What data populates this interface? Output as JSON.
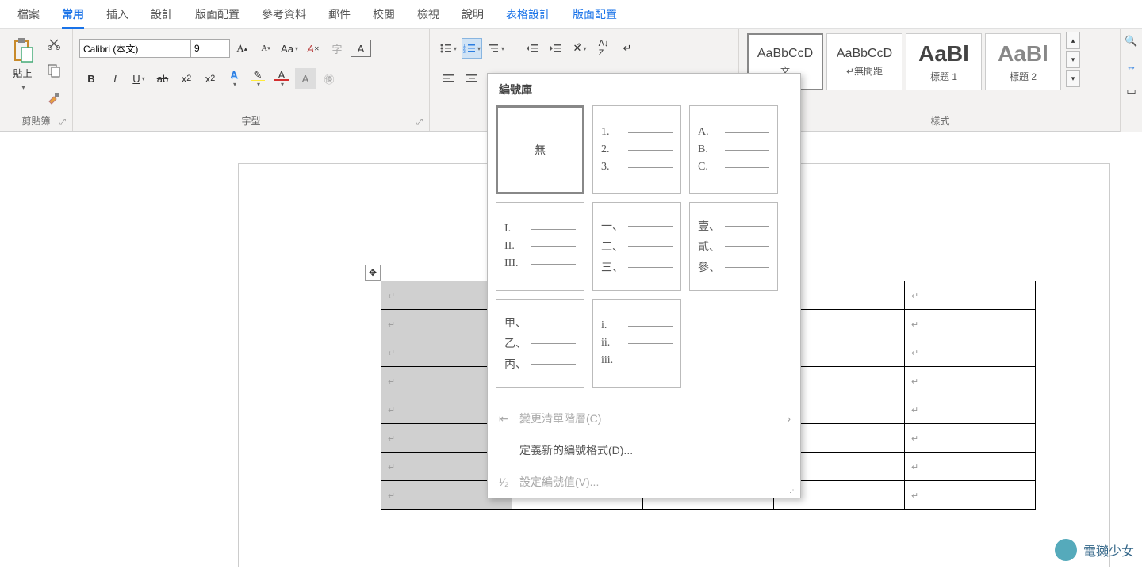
{
  "tabs": {
    "file": "檔案",
    "home": "常用",
    "insert": "插入",
    "design": "設計",
    "layout": "版面配置",
    "references": "參考資料",
    "mailings": "郵件",
    "review": "校閱",
    "view": "檢視",
    "help": "說明",
    "table_design": "表格設計",
    "table_layout": "版面配置"
  },
  "clipboard": {
    "paste": "貼上",
    "label": "剪貼簿"
  },
  "font": {
    "name": "Calibri (本文)",
    "size": "9",
    "label": "字型"
  },
  "styles": {
    "label": "樣式",
    "preview": "AaBbCcD",
    "preview_big": "AaBl",
    "s1_name": "文",
    "s2_name": "↵無間距",
    "s3_name": "標題 1",
    "s4_name": "標題 2"
  },
  "popup": {
    "title": "編號庫",
    "none": "無",
    "opts": {
      "o2": [
        "1.",
        "2.",
        "3."
      ],
      "o3": [
        "A.",
        "B.",
        "C."
      ],
      "o4": [
        "I.",
        "II.",
        "III."
      ],
      "o5": [
        "一、",
        "二、",
        "三、"
      ],
      "o6": [
        "壹、",
        "貳、",
        "參、"
      ],
      "o7": [
        "甲、",
        "乙、",
        "丙、"
      ],
      "o8": [
        "i.",
        "ii.",
        "iii."
      ]
    },
    "change_level": "變更清單階層(C)",
    "define_new": "定義新的編號格式(D)...",
    "set_value": "設定編號值(V)..."
  },
  "watermark": "電獺少女"
}
